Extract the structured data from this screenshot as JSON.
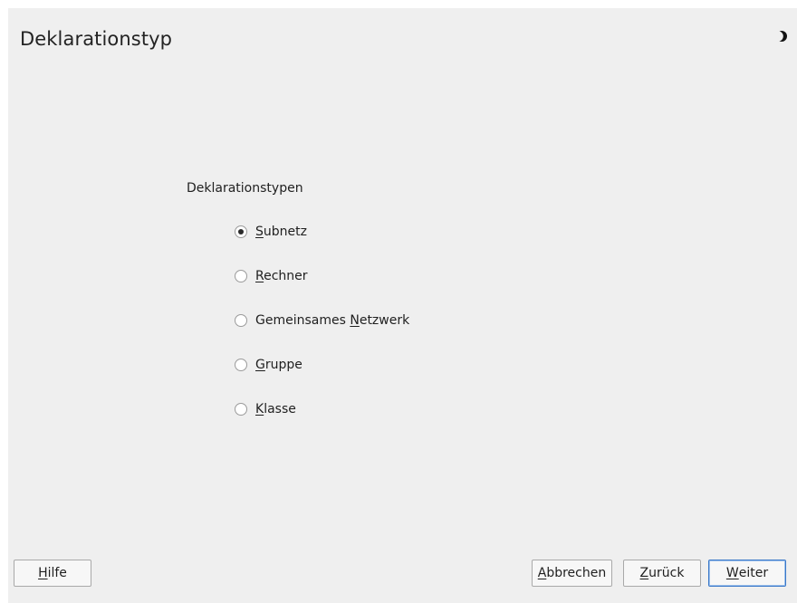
{
  "dialog": {
    "title": "Deklarationstyp"
  },
  "declaration_types": {
    "label": "Deklarationstypen",
    "selected": "Subnetz",
    "options": [
      {
        "pre": "",
        "mnemonic": "S",
        "post": "ubnetz",
        "checked": true
      },
      {
        "pre": "",
        "mnemonic": "R",
        "post": "echner",
        "checked": false
      },
      {
        "pre": "Gemeinsames ",
        "mnemonic": "N",
        "post": "etzwerk",
        "checked": false
      },
      {
        "pre": "",
        "mnemonic": "G",
        "post": "ruppe",
        "checked": false
      },
      {
        "pre": "",
        "mnemonic": "K",
        "post": "lasse",
        "checked": false
      }
    ]
  },
  "buttons": {
    "help": {
      "mnemonic": "H",
      "post": "ilfe"
    },
    "abort": {
      "mnemonic": "A",
      "post": "bbrechen"
    },
    "back": {
      "pre": "",
      "mnemonic": "Z",
      "post": "urück"
    },
    "next": {
      "mnemonic": "W",
      "post": "eiter"
    }
  },
  "icons": {
    "corner": "half-moon-icon"
  }
}
